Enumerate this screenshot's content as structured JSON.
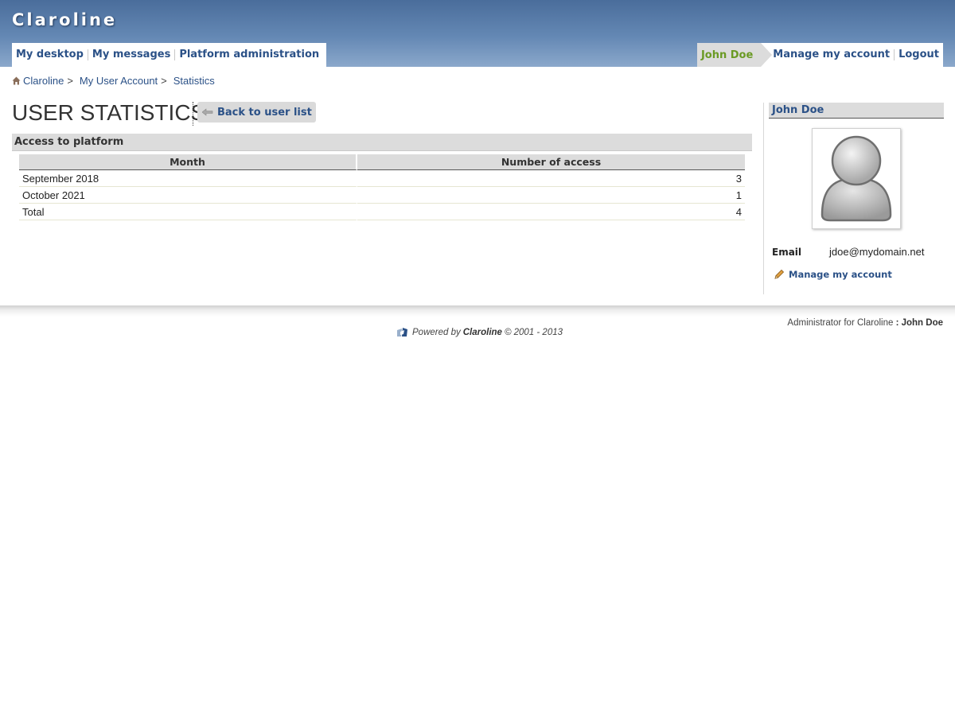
{
  "header": {
    "brand": "Claroline",
    "nav_left": [
      "My desktop",
      "My messages",
      "Platform administration"
    ],
    "user_name": "John Doe",
    "nav_right": [
      "Manage my account",
      "Logout"
    ]
  },
  "breadcrumb": {
    "items": [
      "Claroline",
      "My User Account",
      "Statistics"
    ],
    "separator": ">"
  },
  "page": {
    "title": "USER STATISTICS",
    "back_button": "Back to user list"
  },
  "section": {
    "title": "Access to platform",
    "table": {
      "headers": [
        "Month",
        "Number of access"
      ],
      "rows": [
        [
          "September 2018",
          "3"
        ],
        [
          "October 2021",
          "1"
        ],
        [
          "Total",
          "4"
        ]
      ]
    }
  },
  "profile": {
    "name": "John Doe",
    "email_label": "Email",
    "email": "jdoe@mydomain.net",
    "manage_link": "Manage my account"
  },
  "footer": {
    "admin_prefix": "Administrator for Claroline",
    "admin_sep": ":",
    "admin_name": "John Doe",
    "powered_prefix": "Powered by",
    "powered_brand": "Claroline",
    "powered_suffix": "© 2001 - 2013"
  },
  "colors": {
    "header_top": "#4a6d9b",
    "link": "#2b5187",
    "user_highlight": "#6a9a24",
    "section_bg": "#dcdcdc"
  },
  "icons": [
    "home-icon",
    "back-arrow-icon",
    "avatar-icon",
    "pencil-icon",
    "claroline-logo-icon"
  ]
}
